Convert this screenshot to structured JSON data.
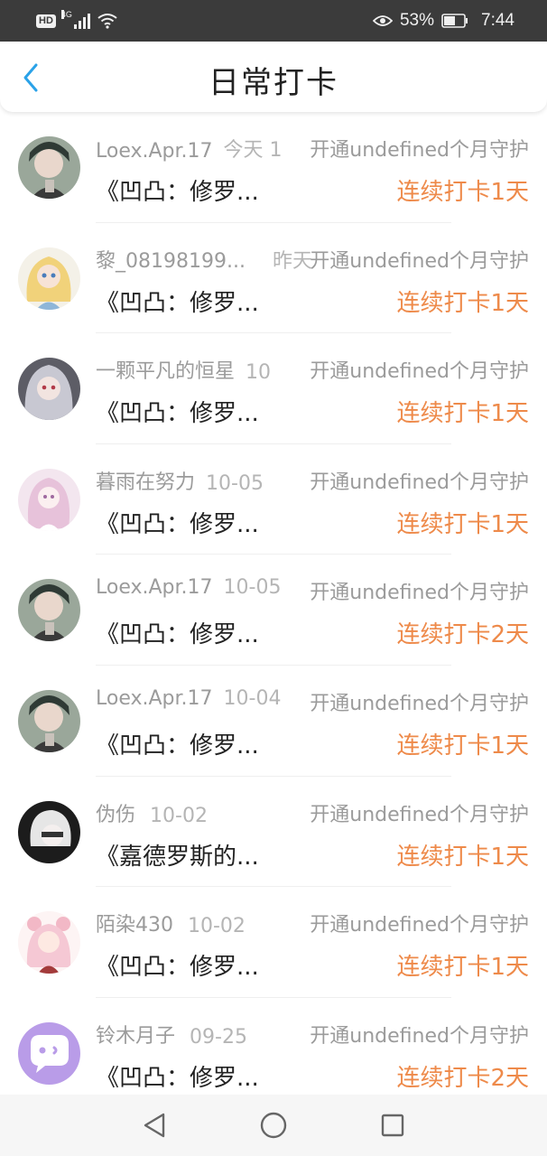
{
  "status_bar": {
    "hd": "HD",
    "network": "4G",
    "battery_percent": "53%",
    "time": "7:44"
  },
  "header": {
    "title": "日常打卡",
    "back_icon": "chevron-left-icon"
  },
  "accent_color": "#ee8a4a",
  "back_color": "#2aa2e8",
  "items": [
    {
      "username": "Loex.Apr.17",
      "date": "今天 1",
      "guard": "开通undefined个月守护",
      "book": "《凹凸：修罗...",
      "streak": "连续打卡1天",
      "avatar": "avatar-dark-hair"
    },
    {
      "username": "黎_08198199...",
      "date": "昨天",
      "guard": "开通undefined个月守护",
      "book": "《凹凸：修罗...",
      "streak": "连续打卡1天",
      "avatar": "avatar-blonde"
    },
    {
      "username": "一颗平凡的恒星",
      "date": "10",
      "guard": "开通undefined个月守护",
      "book": "《凹凸：修罗...",
      "streak": "连续打卡1天",
      "avatar": "avatar-silver-hair"
    },
    {
      "username": "暮雨在努力",
      "date": "10-05",
      "guard": "开通undefined个月守护",
      "book": "《凹凸：修罗...",
      "streak": "连续打卡1天",
      "avatar": "avatar-pink-hair"
    },
    {
      "username": "Loex.Apr.17",
      "date": "10-05",
      "guard": "开通undefined个月守护",
      "book": "《凹凸：修罗...",
      "streak": "连续打卡2天",
      "avatar": "avatar-dark-hair"
    },
    {
      "username": "Loex.Apr.17",
      "date": "10-04",
      "guard": "开通undefined个月守护",
      "book": "《凹凸：修罗...",
      "streak": "连续打卡1天",
      "avatar": "avatar-dark-hair"
    },
    {
      "username": "伪伤",
      "date": "10-02",
      "guard": "开通undefined个月守护",
      "book": "《嘉德罗斯的...",
      "streak": "连续打卡1天",
      "avatar": "avatar-white-hair"
    },
    {
      "username": "陌染430",
      "date": "10-02",
      "guard": "开通undefined个月守护",
      "book": "《凹凸：修罗...",
      "streak": "连续打卡1天",
      "avatar": "avatar-pink-bear"
    },
    {
      "username": "铃木月子",
      "date": "09-25",
      "guard": "开通undefined个月守护",
      "book": "《凹凸：修罗...",
      "streak": "连续打卡2天",
      "avatar": "avatar-default-chat"
    }
  ],
  "nav_bar": {
    "back": "nav-back-icon",
    "home": "nav-home-icon",
    "recents": "nav-recents-icon"
  }
}
